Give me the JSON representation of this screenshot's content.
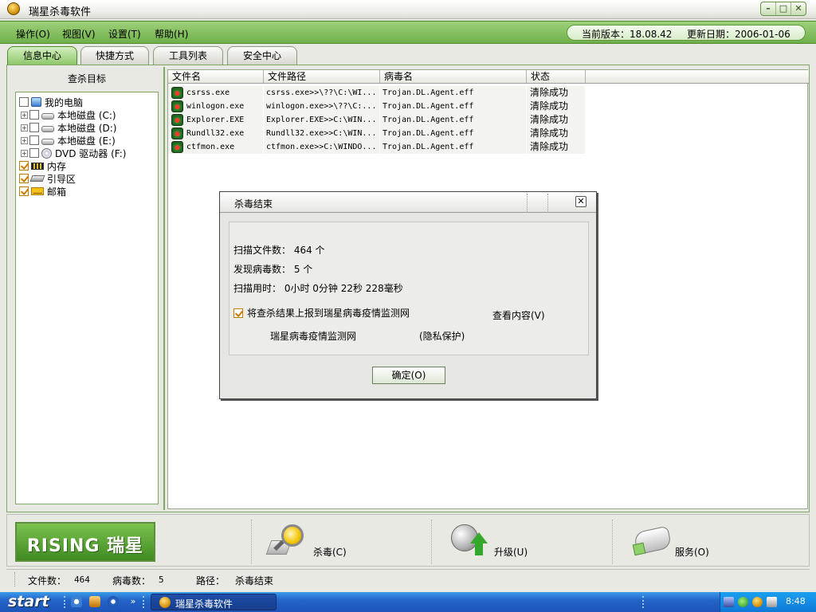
{
  "window": {
    "title": "瑞星杀毒软件",
    "controls": [
      "–",
      "□",
      "✕"
    ]
  },
  "menu": {
    "items": [
      "操作(O)",
      "视图(V)",
      "设置(T)",
      "帮助(H)"
    ],
    "version_label": "当前版本：18.08.42",
    "update_label": "更新日期：2006-01-06"
  },
  "tabs": [
    "信息中心",
    "快捷方式",
    "工具列表",
    "安全中心"
  ],
  "left_panel": {
    "title": "查杀目标",
    "tree": [
      {
        "label": "我的电脑",
        "checked": false,
        "icon": "computer-icon"
      },
      {
        "label": "本地磁盘 (C:)",
        "checked": false,
        "icon": "disk-icon"
      },
      {
        "label": "本地磁盘 (D:)",
        "checked": false,
        "icon": "disk-icon"
      },
      {
        "label": "本地磁盘 (E:)",
        "checked": false,
        "icon": "disk-icon"
      },
      {
        "label": "DVD 驱动器 (F:)",
        "checked": false,
        "icon": "dvd-icon"
      },
      {
        "label": "内存",
        "checked": true,
        "icon": "memory-icon"
      },
      {
        "label": "引导区",
        "checked": true,
        "icon": "boot-sector-icon"
      },
      {
        "label": "邮箱",
        "checked": true,
        "icon": "mail-icon"
      }
    ]
  },
  "results": {
    "columns": [
      "文件名",
      "文件路径",
      "病毒名",
      "状态"
    ],
    "rows": [
      {
        "file": "csrss.exe",
        "path": "csrss.exe>>\\??\\C:\\WI...",
        "virus": "Trojan.DL.Agent.eff",
        "status": "清除成功"
      },
      {
        "file": "winlogon.exe",
        "path": "winlogon.exe>>\\??\\C:...",
        "virus": "Trojan.DL.Agent.eff",
        "status": "清除成功"
      },
      {
        "file": "Explorer.EXE",
        "path": "Explorer.EXE>>C:\\WIN...",
        "virus": "Trojan.DL.Agent.eff",
        "status": "清除成功"
      },
      {
        "file": "Rundll32.exe",
        "path": "Rundll32.exe>>C:\\WIN...",
        "virus": "Trojan.DL.Agent.eff",
        "status": "清除成功"
      },
      {
        "file": "ctfmon.exe",
        "path": "ctfmon.exe>>C:\\WINDO...",
        "virus": "Trojan.DL.Agent.eff",
        "status": "清除成功"
      }
    ]
  },
  "dialog": {
    "title": "杀毒结束",
    "close": "✕",
    "scanned_files": "扫描文件数：  464 个",
    "viruses_found": "发现病毒数：  5 个",
    "time_used": "扫描用时：  0小时 0分钟 22秒 228毫秒",
    "report_checkbox": "将查杀结果上报到瑞星病毒疫情监测网",
    "report_checked": true,
    "view_content": "查看内容(V)",
    "monitor_link": "瑞星病毒疫情监测网",
    "privacy_link": "(隐私保护)",
    "ok": "确定(O)"
  },
  "toolbar": {
    "logo": "RISING 瑞星",
    "kill": "杀毒(C)",
    "upgrade": "升级(U)",
    "service": "服务(O)"
  },
  "statusbar": {
    "files_label": "文件数：",
    "files_value": "464",
    "virus_label": "病毒数：",
    "virus_value": "5",
    "path_label": "路径：",
    "path_value": "杀毒结束"
  },
  "taskbar": {
    "start": "start",
    "task": "瑞星杀毒软件",
    "clock": "8:48"
  },
  "colors": {
    "menu_green": "#7dbb56",
    "tab_active": "#9ccf78",
    "taskbar_blue": "#2464c8"
  }
}
